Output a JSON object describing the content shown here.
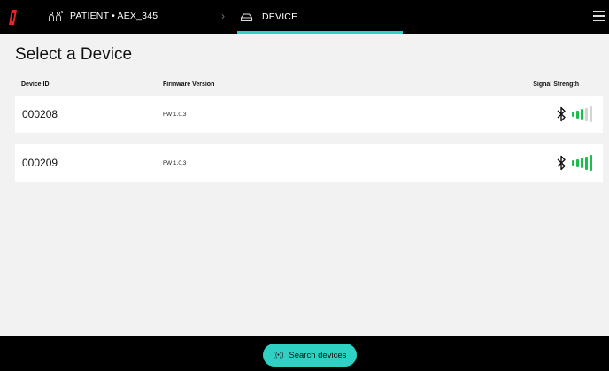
{
  "header": {
    "logo": "brand-logo",
    "patient_icon": "patient-icon",
    "patient_label": "PATIENT • AEX_345",
    "chevron": "chevron-right-icon",
    "device_icon": "device-icon",
    "device_tab_label": "DEVICE",
    "menu_icon": "hamburger-menu-icon",
    "accent_color": "#2fd1c5"
  },
  "main": {
    "title": "Select a Device",
    "columns": {
      "device_id": "Device ID",
      "firmware": "Firmware Version",
      "signal": "Signal Strength"
    },
    "devices": [
      {
        "id": "000208",
        "firmware": "FW 1.0.3",
        "signal_bars": 3,
        "signal_max": 5
      },
      {
        "id": "000209",
        "firmware": "FW 1.0.3",
        "signal_bars": 5,
        "signal_max": 5
      }
    ],
    "signal_color": "#18c04a"
  },
  "footer": {
    "search_label": "Search devices",
    "search_icon": "radar-icon"
  }
}
